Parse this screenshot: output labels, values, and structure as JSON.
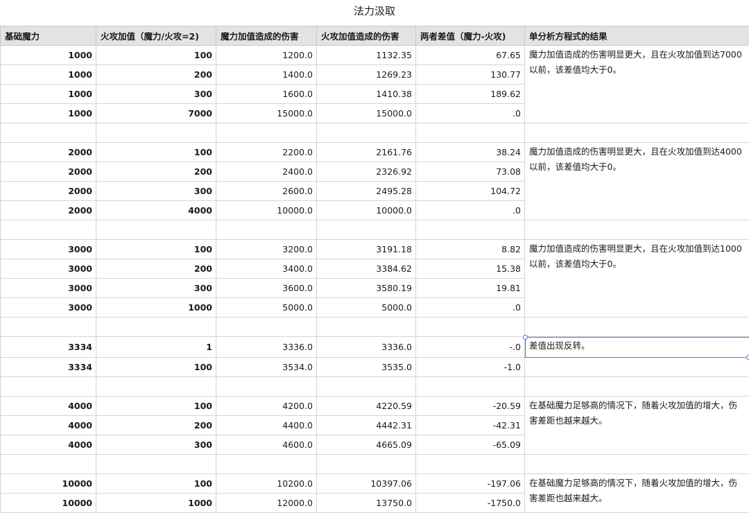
{
  "title": "法力汲取",
  "headers": [
    "基础魔力",
    "火攻加值（魔力/火攻=2)",
    "魔力加值造成的伤害",
    "火攻加值造成的伤害",
    "两者差值（魔力-火攻)",
    "单分析方程式的结果"
  ],
  "groups": [
    {
      "rows": [
        [
          "1000",
          "100",
          "1200.0",
          "1132.35",
          "67.65"
        ],
        [
          "1000",
          "200",
          "1400.0",
          "1269.23",
          "130.77"
        ],
        [
          "1000",
          "300",
          "1600.0",
          "1410.38",
          "189.62"
        ],
        [
          "1000",
          "7000",
          "15000.0",
          "15000.0",
          ".0"
        ]
      ],
      "note": "魔力加值造成的伤害明显更大，且在火攻加值到达7000以前，该差值均大于0。"
    },
    {
      "rows": [
        [
          "2000",
          "100",
          "2200.0",
          "2161.76",
          "38.24"
        ],
        [
          "2000",
          "200",
          "2400.0",
          "2326.92",
          "73.08"
        ],
        [
          "2000",
          "300",
          "2600.0",
          "2495.28",
          "104.72"
        ],
        [
          "2000",
          "4000",
          "10000.0",
          "10000.0",
          ".0"
        ]
      ],
      "note": "魔力加值造成的伤害明显更大，且在火攻加值到达4000以前，该差值均大于0。"
    },
    {
      "rows": [
        [
          "3000",
          "100",
          "3200.0",
          "3191.18",
          "8.82"
        ],
        [
          "3000",
          "200",
          "3400.0",
          "3384.62",
          "15.38"
        ],
        [
          "3000",
          "300",
          "3600.0",
          "3580.19",
          "19.81"
        ],
        [
          "3000",
          "1000",
          "5000.0",
          "5000.0",
          ".0"
        ]
      ],
      "note": "魔力加值造成的伤害明显更大，且在火攻加值到达1000以前，该差值均大于0。"
    },
    {
      "rows": [
        [
          "3334",
          "1",
          "3336.0",
          "3336.0",
          "-.0"
        ],
        [
          "3334",
          "100",
          "3534.0",
          "3535.0",
          "-1.0"
        ]
      ],
      "note": "差值出现反转。",
      "note_span": 1
    },
    {
      "rows": [
        [
          "4000",
          "100",
          "4200.0",
          "4220.59",
          "-20.59"
        ],
        [
          "4000",
          "200",
          "4400.0",
          "4442.31",
          "-42.31"
        ],
        [
          "4000",
          "300",
          "4600.0",
          "4665.09",
          "-65.09"
        ]
      ],
      "note": "在基础魔力足够高的情况下，随着火攻加值的增大，伤害差距也越来越大。"
    },
    {
      "rows": [
        [
          "10000",
          "100",
          "10200.0",
          "10397.06",
          "-197.06"
        ],
        [
          "10000",
          "1000",
          "12000.0",
          "13750.0",
          "-1750.0"
        ]
      ],
      "note": "在基础魔力足够高的情况下，随着火攻加值的增大，伤害差距也越来越大。"
    }
  ]
}
